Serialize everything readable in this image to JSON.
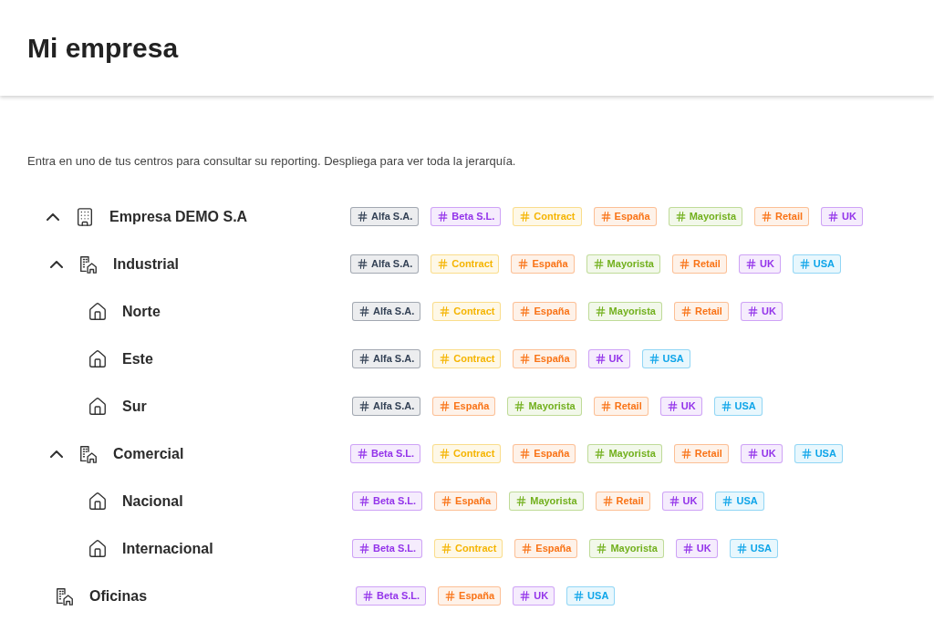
{
  "header": {
    "title": "Mi empresa"
  },
  "description": "Entra en uno de tus centros para consultar su reporting. Despliega para ver toda la jerarquía.",
  "tree": [
    {
      "name": "Empresa DEMO S.A",
      "kind": "company",
      "expanded": true,
      "tags": [
        {
          "label": "Alfa S.A.",
          "color": "#334155"
        },
        {
          "label": "Beta S.L.",
          "color": "#9333ea"
        },
        {
          "label": "Contract",
          "color": "#f5b400"
        },
        {
          "label": "España",
          "color": "#f97316"
        },
        {
          "label": "Mayorista",
          "color": "#72b01d"
        },
        {
          "label": "Retail",
          "color": "#f97316"
        },
        {
          "label": "UK",
          "color": "#9333ea"
        }
      ],
      "children": [
        {
          "name": "Industrial",
          "kind": "group",
          "expanded": true,
          "tags": [
            {
              "label": "Alfa S.A.",
              "color": "#334155"
            },
            {
              "label": "Contract",
              "color": "#f5b400"
            },
            {
              "label": "España",
              "color": "#f97316"
            },
            {
              "label": "Mayorista",
              "color": "#72b01d"
            },
            {
              "label": "Retail",
              "color": "#f97316"
            },
            {
              "label": "UK",
              "color": "#9333ea"
            },
            {
              "label": "USA",
              "color": "#0ea5e9"
            }
          ],
          "children": [
            {
              "name": "Norte",
              "kind": "center",
              "tags": [
                {
                  "label": "Alfa S.A.",
                  "color": "#334155"
                },
                {
                  "label": "Contract",
                  "color": "#f5b400"
                },
                {
                  "label": "España",
                  "color": "#f97316"
                },
                {
                  "label": "Mayorista",
                  "color": "#72b01d"
                },
                {
                  "label": "Retail",
                  "color": "#f97316"
                },
                {
                  "label": "UK",
                  "color": "#9333ea"
                }
              ]
            },
            {
              "name": "Este",
              "kind": "center",
              "tags": [
                {
                  "label": "Alfa S.A.",
                  "color": "#334155"
                },
                {
                  "label": "Contract",
                  "color": "#f5b400"
                },
                {
                  "label": "España",
                  "color": "#f97316"
                },
                {
                  "label": "UK",
                  "color": "#9333ea"
                },
                {
                  "label": "USA",
                  "color": "#0ea5e9"
                }
              ]
            },
            {
              "name": "Sur",
              "kind": "center",
              "tags": [
                {
                  "label": "Alfa S.A.",
                  "color": "#334155"
                },
                {
                  "label": "España",
                  "color": "#f97316"
                },
                {
                  "label": "Mayorista",
                  "color": "#72b01d"
                },
                {
                  "label": "Retail",
                  "color": "#f97316"
                },
                {
                  "label": "UK",
                  "color": "#9333ea"
                },
                {
                  "label": "USA",
                  "color": "#0ea5e9"
                }
              ]
            }
          ]
        },
        {
          "name": "Comercial",
          "kind": "group",
          "expanded": true,
          "tags": [
            {
              "label": "Beta S.L.",
              "color": "#9333ea"
            },
            {
              "label": "Contract",
              "color": "#f5b400"
            },
            {
              "label": "España",
              "color": "#f97316"
            },
            {
              "label": "Mayorista",
              "color": "#72b01d"
            },
            {
              "label": "Retail",
              "color": "#f97316"
            },
            {
              "label": "UK",
              "color": "#9333ea"
            },
            {
              "label": "USA",
              "color": "#0ea5e9"
            }
          ],
          "children": [
            {
              "name": "Nacional",
              "kind": "center",
              "tags": [
                {
                  "label": "Beta S.L.",
                  "color": "#9333ea"
                },
                {
                  "label": "España",
                  "color": "#f97316"
                },
                {
                  "label": "Mayorista",
                  "color": "#72b01d"
                },
                {
                  "label": "Retail",
                  "color": "#f97316"
                },
                {
                  "label": "UK",
                  "color": "#9333ea"
                },
                {
                  "label": "USA",
                  "color": "#0ea5e9"
                }
              ]
            },
            {
              "name": "Internacional",
              "kind": "center",
              "tags": [
                {
                  "label": "Beta S.L.",
                  "color": "#9333ea"
                },
                {
                  "label": "Contract",
                  "color": "#f5b400"
                },
                {
                  "label": "España",
                  "color": "#f97316"
                },
                {
                  "label": "Mayorista",
                  "color": "#72b01d"
                },
                {
                  "label": "UK",
                  "color": "#9333ea"
                },
                {
                  "label": "USA",
                  "color": "#0ea5e9"
                }
              ]
            }
          ]
        },
        {
          "name": "Oficinas",
          "kind": "office",
          "tags": [
            {
              "label": "Beta S.L.",
              "color": "#9333ea"
            },
            {
              "label": "España",
              "color": "#f97316"
            },
            {
              "label": "UK",
              "color": "#9333ea"
            },
            {
              "label": "USA",
              "color": "#0ea5e9"
            }
          ]
        }
      ]
    }
  ]
}
